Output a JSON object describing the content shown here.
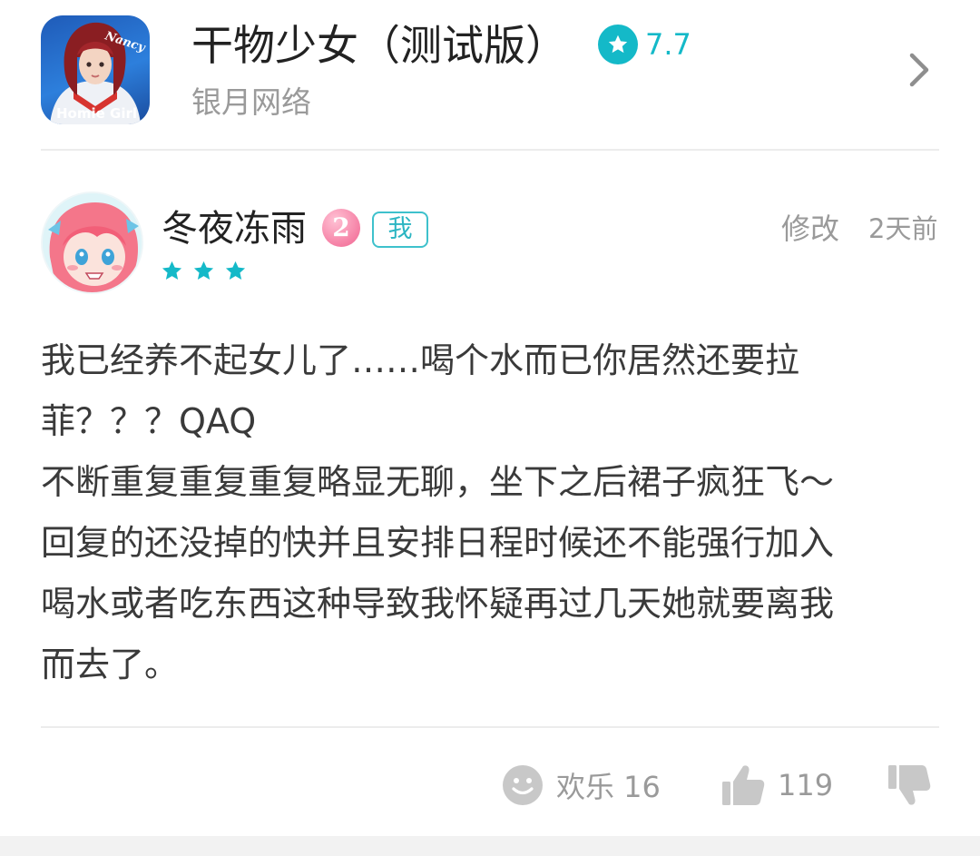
{
  "app": {
    "icon_name": "homie-girl-app-icon",
    "icon_text_script": "Nancy",
    "icon_text_brand": "Homie Girl",
    "title": "干物少女（测试版）",
    "rating_icon": "star-icon",
    "rating": "7.7",
    "developer": "银月网络",
    "chevron_icon": "chevron-right-icon"
  },
  "review": {
    "avatar_icon": "user-avatar",
    "username": "冬夜冻雨",
    "level": "2",
    "me_tag": "我",
    "stars": [
      "star",
      "star",
      "star"
    ],
    "edit_label": "修改",
    "time_ago": "2天前",
    "body_lines": [
      "我已经养不起女儿了……喝个水而已你居然还要拉",
      "菲？？？QAQ",
      "不断重复重复重复略显无聊，坐下之后裙子疯狂飞～",
      "回复的还没掉的快并且安排日程时候还不能强行加入",
      "喝水或者吃东西这种导致我怀疑再过几天她就要离我",
      "而去了。"
    ]
  },
  "actions": {
    "fun_icon": "smiley-icon",
    "fun_label": "欢乐 16",
    "like_icon": "thumbs-up-icon",
    "like_count": "119",
    "dislike_icon": "thumbs-down-icon"
  },
  "colors": {
    "accent": "#14b9c8",
    "text_primary": "#222222",
    "text_secondary": "#9a9a9a",
    "level_badge": "#f57fa4",
    "divider": "#ececec"
  }
}
